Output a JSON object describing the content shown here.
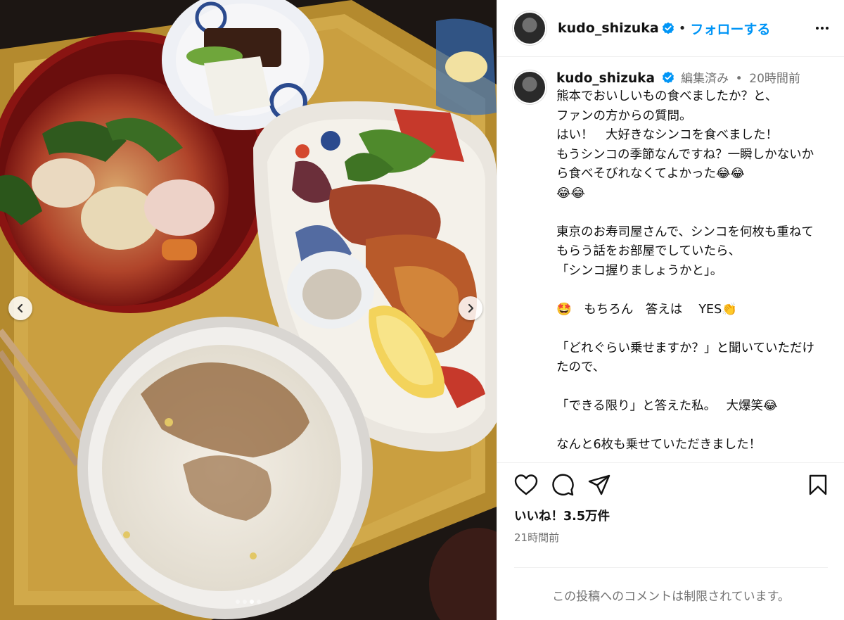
{
  "header": {
    "username": "kudo_shizuka",
    "separator": "•",
    "follow_label": "フォローする"
  },
  "caption": {
    "username": "kudo_shizuka",
    "edited": "編集済み",
    "separator": "•",
    "time_ago": "20時間前",
    "text": "熊本でおいしいもの食べましたか？と、\nファンの方からの質問。\nはい！　大好きなシンコを食べました！\nもうシンコの季節なんですね？一瞬しかないから食べそびれなくてよかった😂😂\n😂😂\n\n東京のお寿司屋さんで、シンコを何枚も重ねてもらう話をお部屋でしていたら、\n「シンコ握りましょうかと」。\n\n🤩　もちろん　答えは　 YES👏\n\n「どれぐらい乗せますか？」と聞いていただけたので、\n\n「できる限り」と答えた私。　 大爆笑😂\n\nなんと6枚も乗せていただきました！"
  },
  "actions": {
    "likes": "いいね！3.5万件",
    "posted": "21時間前",
    "comments_limited": "この投稿へのコメントは制限されています。"
  },
  "carousel": {
    "total": 4,
    "active_index": 2
  },
  "icons": {
    "verified": "verified-badge-icon",
    "more": "more-options-icon",
    "like": "heart-icon",
    "comment": "comment-icon",
    "share": "share-icon",
    "save": "bookmark-icon",
    "prev": "chevron-left-icon",
    "next": "chevron-right-icon"
  },
  "colors": {
    "accent": "#0095f6",
    "verified": "#0095f6",
    "muted": "#737373"
  }
}
